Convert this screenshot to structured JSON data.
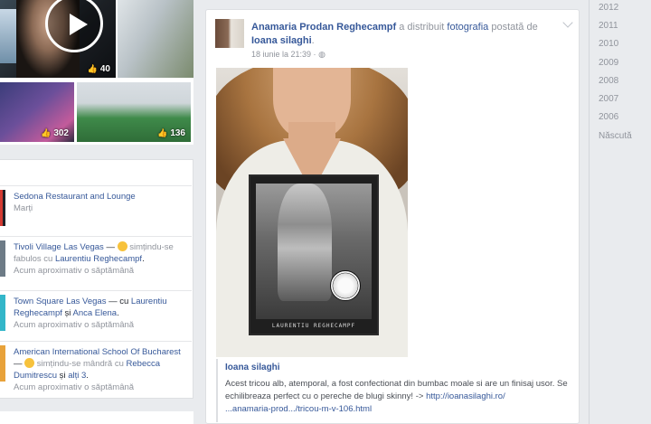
{
  "video_grid": {
    "counts": [
      "40",
      "302",
      "136"
    ]
  },
  "checkins": [
    {
      "place": "Sedona Restaurant and Lounge",
      "meta": "Marți"
    },
    {
      "place": "Tivoli Village Las Vegas",
      "dash": " — ",
      "activity": " simțindu-se fabulos cu ",
      "person": "Laurentiu Reghecampf",
      "end": ".",
      "meta": "Acum aproximativ o săptămână"
    },
    {
      "place": "Town Square Las Vegas",
      "dash": " — cu ",
      "person": "Laurentiu Reghecampf",
      "mid": " și ",
      "person2": "Anca Elena",
      "end": ".",
      "meta": "Acum aproximativ o săptămână"
    },
    {
      "place": "American International School Of Bucharest",
      "dash": " — ",
      "activity": " simțindu-se mândră cu ",
      "person": "Rebecca Dumitrescu",
      "mid": " și ",
      "person2": "alți 3",
      "end": ".",
      "meta": "Acum aproximativ o săptămână"
    }
  ],
  "post": {
    "author": "Anamaria Prodan Reghecampf",
    "action": " a distribuit ",
    "object": "fotografia",
    "action2": " postată de ",
    "owner": "Ioana silaghi",
    "end": ".",
    "time": "18 iunie la 21:39 · ",
    "print_caption": "LAURENTIU REGHECAMPF",
    "share_name": "Ioana silaghi",
    "share_desc1": "Acest tricou alb, atemporal, a fost confectionat din bumbac moale si are un finisaj usor. Se echilibreaza perfect cu o pereche de blugi skinny! -> ",
    "share_link1": "http://ioanasilaghi.ro/",
    "share_link2": "...anamaria-prod.../tricou-m-v-106.html"
  },
  "years": [
    "2012",
    "2011",
    "2010",
    "2009",
    "2008",
    "2007",
    "2006",
    "Născută"
  ],
  "colors": {
    "link": "#365899",
    "meta": "#90949c",
    "bar_dark": "#1d2129",
    "bar_red": "#d33a32",
    "bar_teal": "#33b6c9",
    "bar_orange": "#e8a23a"
  }
}
